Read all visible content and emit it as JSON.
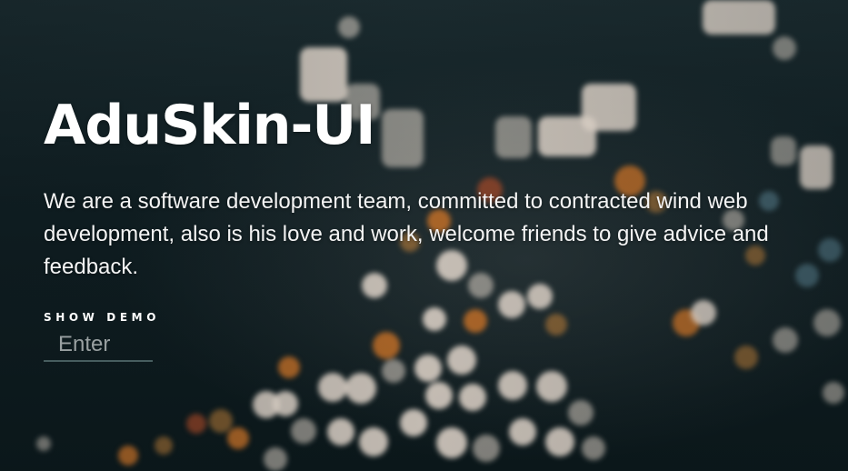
{
  "hero": {
    "title": "AduSkin-UI",
    "description": "We are a software development team, committed to contracted wind web development, also is his love and work, welcome friends to give advice and feedback.",
    "demo_label": "SHOW DEMO",
    "input_placeholder": "Enter",
    "input_value": ""
  },
  "theme": {
    "text_color": "#ffffff",
    "background_color": "#0f1d21"
  }
}
